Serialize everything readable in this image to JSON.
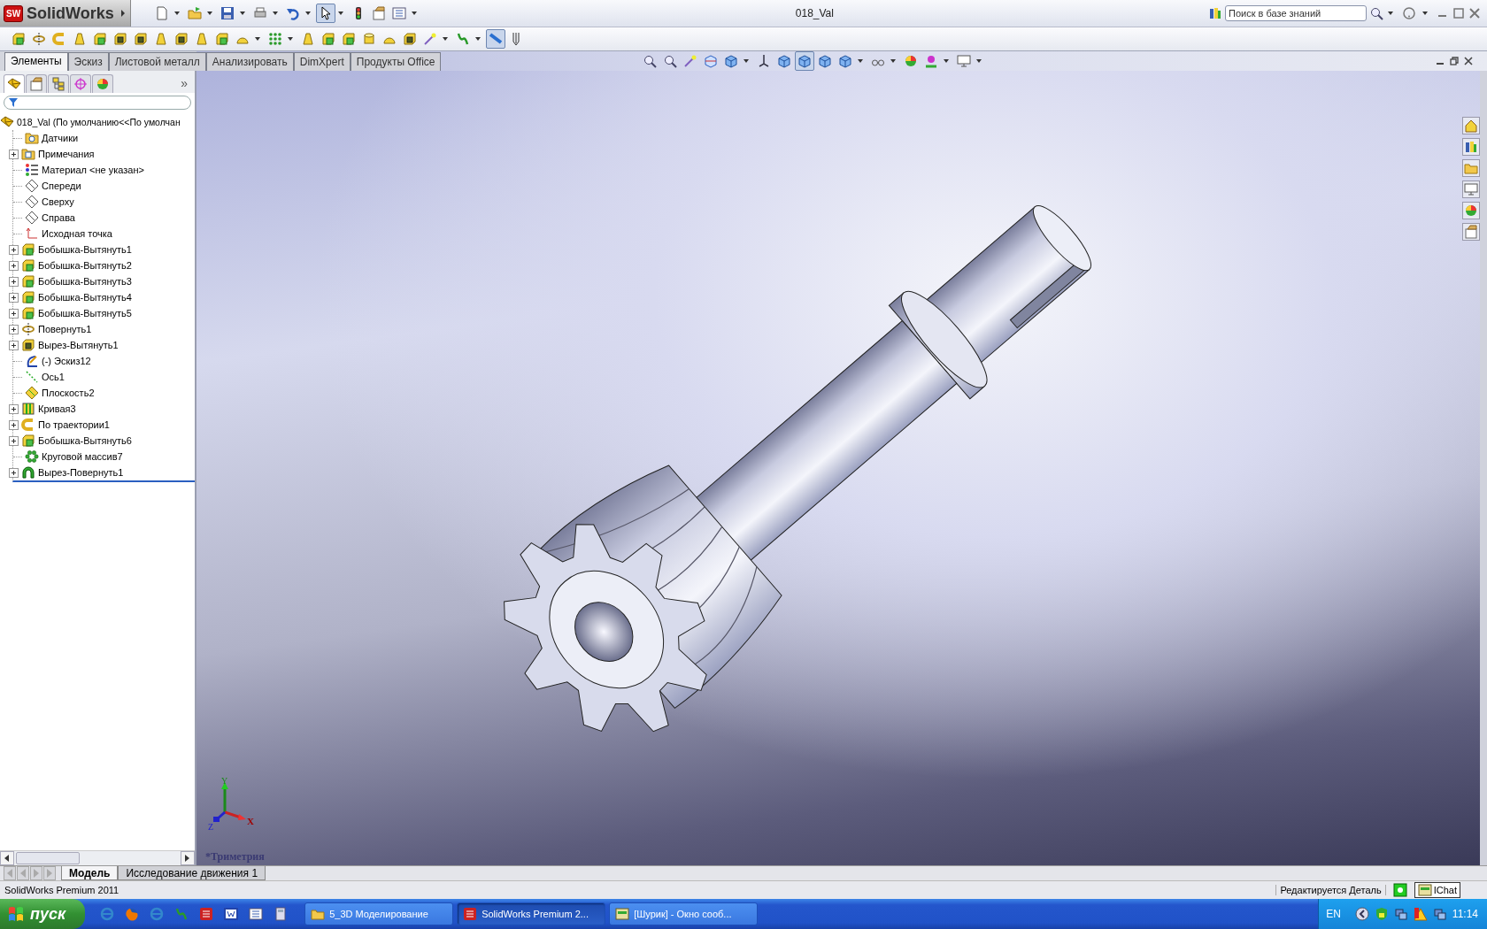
{
  "app": {
    "logo_mark": "SW",
    "logo_text": "SolidWorks",
    "title": "018_Val"
  },
  "quick_access": [
    {
      "kind": "new",
      "dropdown": true,
      "pressed": false
    },
    {
      "kind": "open",
      "dropdown": true,
      "pressed": false
    },
    {
      "kind": "save",
      "dropdown": true,
      "pressed": false
    },
    {
      "kind": "print",
      "dropdown": true,
      "pressed": false
    },
    {
      "kind": "undo",
      "dropdown": true,
      "pressed": false
    },
    {
      "kind": "select",
      "dropdown": true,
      "pressed": true
    },
    {
      "kind": "light",
      "dropdown": false,
      "pressed": false
    },
    {
      "kind": "options",
      "dropdown": false,
      "pressed": false
    },
    {
      "kind": "list",
      "dropdown": true,
      "pressed": false
    }
  ],
  "search": {
    "placeholder": "Поиск в базе знаний"
  },
  "features_toolbar": [
    {
      "kind": "box",
      "dropdown": false,
      "pressed": false
    },
    {
      "kind": "revolve",
      "dropdown": false,
      "pressed": false
    },
    {
      "kind": "sweep",
      "dropdown": false,
      "pressed": false
    },
    {
      "kind": "cone",
      "dropdown": false,
      "pressed": false
    },
    {
      "kind": "box",
      "dropdown": false,
      "pressed": false
    },
    {
      "kind": "cut",
      "dropdown": false,
      "pressed": false
    },
    {
      "kind": "cut",
      "dropdown": false,
      "pressed": false
    },
    {
      "kind": "cone",
      "dropdown": false,
      "pressed": false
    },
    {
      "kind": "cut",
      "dropdown": false,
      "pressed": false
    },
    {
      "kind": "cone",
      "dropdown": false,
      "pressed": false
    },
    {
      "kind": "box",
      "dropdown": false,
      "pressed": false
    },
    {
      "kind": "dome",
      "dropdown": true,
      "pressed": false
    },
    {
      "kind": "pattern",
      "dropdown": true,
      "pressed": false
    },
    {
      "kind": "cone",
      "dropdown": false,
      "pressed": false
    },
    {
      "kind": "box",
      "dropdown": false,
      "pressed": false
    },
    {
      "kind": "box",
      "dropdown": false,
      "pressed": false
    },
    {
      "kind": "cylinder",
      "dropdown": false,
      "pressed": false
    },
    {
      "kind": "dome",
      "dropdown": false,
      "pressed": false
    },
    {
      "kind": "cut",
      "dropdown": false,
      "pressed": false
    },
    {
      "kind": "spark",
      "dropdown": true,
      "pressed": false
    },
    {
      "kind": "curve",
      "dropdown": true,
      "pressed": false
    },
    {
      "kind": "ruler",
      "dropdown": false,
      "pressed": true
    },
    {
      "kind": "probe",
      "dropdown": false,
      "pressed": false
    }
  ],
  "command_tabs": [
    {
      "label": "Элементы",
      "selected": true
    },
    {
      "label": "Эскиз",
      "selected": false
    },
    {
      "label": "Листовой металл",
      "selected": false
    },
    {
      "label": "Анализировать",
      "selected": false
    },
    {
      "label": "DimXpert",
      "selected": false
    },
    {
      "label": "Продукты Office",
      "selected": false
    }
  ],
  "view_toolbar": [
    {
      "kind": "zoomfit",
      "dropdown": false,
      "pressed": false
    },
    {
      "kind": "zoomfit",
      "dropdown": false,
      "pressed": false
    },
    {
      "kind": "spark",
      "dropdown": false,
      "pressed": false
    },
    {
      "kind": "section",
      "dropdown": false,
      "pressed": false
    },
    {
      "kind": "viewcube",
      "dropdown": true,
      "pressed": false
    },
    {
      "kind": "axes",
      "dropdown": false,
      "pressed": false
    },
    {
      "kind": "viewcube",
      "dropdown": false,
      "pressed": false
    },
    {
      "kind": "viewcube",
      "dropdown": false,
      "pressed": true
    },
    {
      "kind": "viewcube",
      "dropdown": false,
      "pressed": false
    },
    {
      "kind": "viewcube",
      "dropdown": true,
      "pressed": false
    },
    {
      "kind": "hide",
      "dropdown": true,
      "pressed": false
    },
    {
      "kind": "appearance",
      "dropdown": false,
      "pressed": false
    },
    {
      "kind": "scene",
      "dropdown": true,
      "pressed": false
    },
    {
      "kind": "display",
      "dropdown": true,
      "pressed": false
    }
  ],
  "feature_manager": {
    "panel_tabs": [
      {
        "kind": "part",
        "selected": true
      },
      {
        "kind": "options",
        "selected": false
      },
      {
        "kind": "config",
        "selected": false
      },
      {
        "kind": "target",
        "selected": false
      },
      {
        "kind": "appearance",
        "selected": false
      }
    ],
    "more": "»",
    "tree": {
      "label": "018_Val  (По умолчанию<<По умолчан",
      "kind": "part",
      "children": [
        {
          "label": "Датчики",
          "kind": "sensors",
          "expandable": false
        },
        {
          "label": "Примечания",
          "kind": "annotations",
          "expandable": true
        },
        {
          "label": "Материал <не указан>",
          "kind": "material",
          "expandable": false
        },
        {
          "label": "Спереди",
          "kind": "plane",
          "expandable": false
        },
        {
          "label": "Сверху",
          "kind": "plane",
          "expandable": false
        },
        {
          "label": "Справа",
          "kind": "plane",
          "expandable": false
        },
        {
          "label": "Исходная точка",
          "kind": "origin",
          "expandable": false
        },
        {
          "label": "Бобышка-Вытянуть1",
          "kind": "box",
          "expandable": true
        },
        {
          "label": "Бобышка-Вытянуть2",
          "kind": "box",
          "expandable": true
        },
        {
          "label": "Бобышка-Вытянуть3",
          "kind": "box",
          "expandable": true
        },
        {
          "label": "Бобышка-Вытянуть4",
          "kind": "box",
          "expandable": true
        },
        {
          "label": "Бобышка-Вытянуть5",
          "kind": "box",
          "expandable": true
        },
        {
          "label": "Повернуть1",
          "kind": "revolve",
          "expandable": true
        },
        {
          "label": "Вырез-Вытянуть1",
          "kind": "cut",
          "expandable": true
        },
        {
          "label": "(-) Эскиз12",
          "kind": "sketch",
          "expandable": false
        },
        {
          "label": "Ось1",
          "kind": "axis",
          "expandable": false
        },
        {
          "label": "Плоскость2",
          "kind": "refplane",
          "expandable": false
        },
        {
          "label": "Кривая3",
          "kind": "helix",
          "expandable": true
        },
        {
          "label": "По траектории1",
          "kind": "sweep",
          "expandable": true
        },
        {
          "label": "Бобышка-Вытянуть6",
          "kind": "box",
          "expandable": true
        },
        {
          "label": "Круговой массив7",
          "kind": "circpattern",
          "expandable": false
        },
        {
          "label": "Вырез-Повернуть1",
          "kind": "cutrev",
          "expandable": true
        }
      ]
    }
  },
  "viewport": {
    "view_name": "*Триметрия",
    "triad": {
      "x": "X",
      "y": "Y",
      "z": "Z"
    }
  },
  "bottom_tabs": [
    {
      "label": "Модель",
      "selected": true
    },
    {
      "label": "Исследование движения 1",
      "selected": false
    }
  ],
  "status_bar": {
    "product": "SolidWorks Premium 2011",
    "mode": "Редактируется Деталь",
    "chat": "IChat"
  },
  "taskbar": {
    "start": "пуск",
    "tasks": [
      {
        "label": "5_3D Моделирование",
        "kind": "folder",
        "selected": false
      },
      {
        "label": "SolidWorks Premium 2...",
        "kind": "sw",
        "selected": true
      },
      {
        "label": "[Шурик] - Окно сооб...",
        "kind": "chat",
        "selected": false
      }
    ],
    "language": "EN",
    "clock": "11:14"
  }
}
